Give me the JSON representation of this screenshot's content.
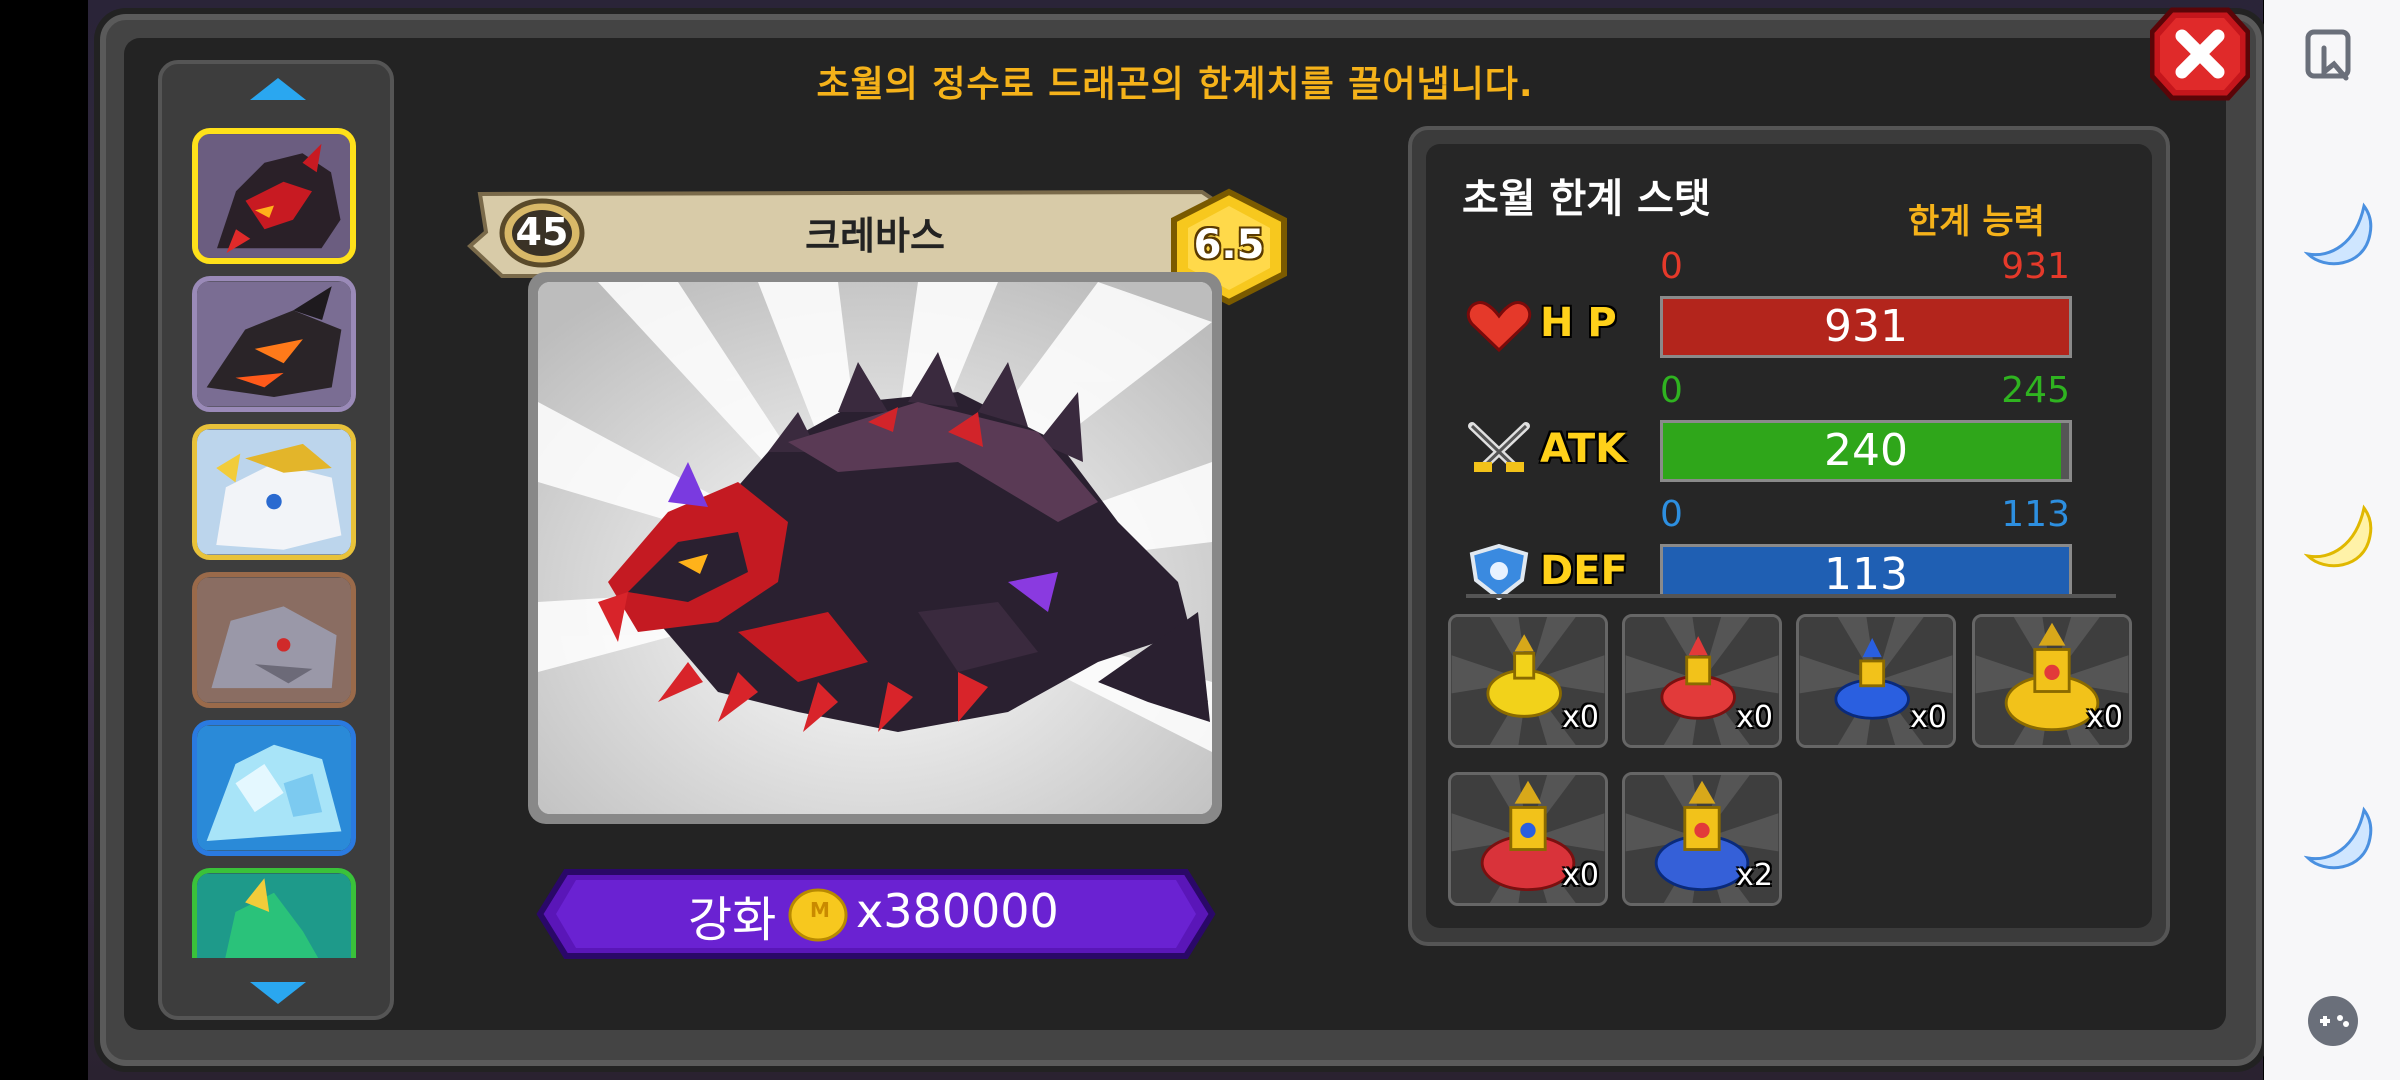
{
  "header": {
    "title": "초월의 정수로 드래곤의 한계치를 끌어냅니다.",
    "close_icon": "close-x-icon"
  },
  "dragon_list": {
    "up_icon": "arrow-up-icon",
    "down_icon": "arrow-down-icon",
    "items": [
      {
        "name": "crimson-armored-dragon",
        "selected": true
      },
      {
        "name": "dark-flame-dragon",
        "selected": false
      },
      {
        "name": "white-gold-dragon",
        "selected": false
      },
      {
        "name": "gray-stone-dragon",
        "selected": false
      },
      {
        "name": "ice-crystal-dragon",
        "selected": false
      },
      {
        "name": "green-dragon",
        "selected": false
      }
    ]
  },
  "dragon": {
    "level": "45",
    "name": "크레바스",
    "grade": "6.5"
  },
  "enhance": {
    "label": "강화",
    "coin_icon": "coin-icon",
    "coin_mark": "M",
    "cost": "x380000"
  },
  "stats": {
    "title": "초월 한계 스탯",
    "limit_label": "한계 능력",
    "items": [
      {
        "key": "hp",
        "name": "H P",
        "icon": "heart-icon",
        "min": "0",
        "max": "931",
        "value": "931",
        "fraction": 1.0,
        "color": "#b3251c",
        "label_color": "#e5392a"
      },
      {
        "key": "atk",
        "name": "ATK",
        "icon": "crossed-swords-icon",
        "min": "0",
        "max": "245",
        "value": "240",
        "fraction": 0.98,
        "color": "#2fa61a",
        "label_color": "#2fb320"
      },
      {
        "key": "def",
        "name": "DEF",
        "icon": "shield-icon",
        "min": "0",
        "max": "113",
        "value": "113",
        "fraction": 1.0,
        "color": "#1f5fb3",
        "label_color": "#2d8fe0"
      }
    ]
  },
  "essences": [
    {
      "name": "yellow-essence",
      "count": "x0",
      "color": "#f2d21a"
    },
    {
      "name": "red-essence",
      "count": "x0",
      "color": "#e23a3a"
    },
    {
      "name": "blue-essence",
      "count": "x0",
      "color": "#2a5fe0"
    },
    {
      "name": "large-yellow-essence",
      "count": "x0",
      "color": "#f2c21a"
    },
    {
      "name": "large-red-essence",
      "count": "x0",
      "color": "#d9333a"
    },
    {
      "name": "large-blue-essence",
      "count": "x2",
      "color": "#3560d8"
    }
  ],
  "system_bar": {
    "icons": [
      "touch-lock-icon",
      "moon-icon",
      "moon-icon",
      "moon-icon",
      "gamepad-icon"
    ]
  }
}
